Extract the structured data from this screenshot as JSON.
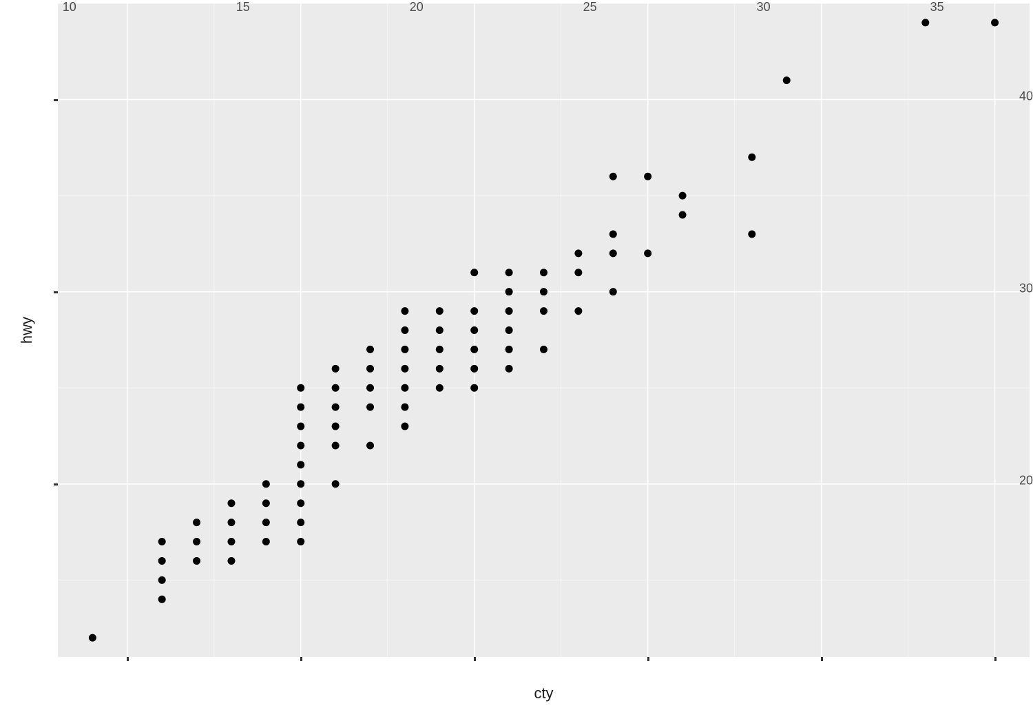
{
  "chart_data": {
    "type": "scatter",
    "xlabel": "cty",
    "ylabel": "hwy",
    "xlim": [
      8,
      36
    ],
    "ylim": [
      11,
      45
    ],
    "x_ticks": [
      10,
      15,
      20,
      25,
      30,
      35
    ],
    "y_ticks": [
      20,
      30,
      40
    ],
    "x_minor": [
      12.5,
      17.5,
      22.5,
      27.5,
      32.5
    ],
    "y_minor": [
      15,
      25,
      35,
      45
    ],
    "point_radius": 5.5,
    "points": [
      [
        9,
        12
      ],
      [
        11,
        14
      ],
      [
        11,
        15
      ],
      [
        11,
        16
      ],
      [
        11,
        17
      ],
      [
        12,
        16
      ],
      [
        12,
        17
      ],
      [
        12,
        18
      ],
      [
        13,
        16
      ],
      [
        13,
        17
      ],
      [
        13,
        18
      ],
      [
        13,
        19
      ],
      [
        14,
        17
      ],
      [
        14,
        18
      ],
      [
        14,
        19
      ],
      [
        14,
        20
      ],
      [
        15,
        17
      ],
      [
        15,
        18
      ],
      [
        15,
        19
      ],
      [
        15,
        20
      ],
      [
        15,
        21
      ],
      [
        15,
        22
      ],
      [
        15,
        23
      ],
      [
        15,
        24
      ],
      [
        15,
        25
      ],
      [
        16,
        20
      ],
      [
        16,
        22
      ],
      [
        16,
        23
      ],
      [
        16,
        24
      ],
      [
        16,
        25
      ],
      [
        16,
        26
      ],
      [
        17,
        22
      ],
      [
        17,
        24
      ],
      [
        17,
        25
      ],
      [
        17,
        26
      ],
      [
        17,
        27
      ],
      [
        18,
        23
      ],
      [
        18,
        24
      ],
      [
        18,
        25
      ],
      [
        18,
        26
      ],
      [
        18,
        27
      ],
      [
        18,
        28
      ],
      [
        18,
        29
      ],
      [
        19,
        25
      ],
      [
        19,
        26
      ],
      [
        19,
        27
      ],
      [
        19,
        28
      ],
      [
        19,
        29
      ],
      [
        20,
        25
      ],
      [
        20,
        26
      ],
      [
        20,
        27
      ],
      [
        20,
        28
      ],
      [
        20,
        29
      ],
      [
        20,
        31
      ],
      [
        21,
        26
      ],
      [
        21,
        27
      ],
      [
        21,
        28
      ],
      [
        21,
        29
      ],
      [
        21,
        30
      ],
      [
        21,
        31
      ],
      [
        22,
        27
      ],
      [
        22,
        29
      ],
      [
        22,
        30
      ],
      [
        22,
        31
      ],
      [
        23,
        29
      ],
      [
        23,
        31
      ],
      [
        23,
        32
      ],
      [
        24,
        30
      ],
      [
        24,
        32
      ],
      [
        24,
        33
      ],
      [
        24,
        36
      ],
      [
        25,
        32
      ],
      [
        25,
        36
      ],
      [
        26,
        34
      ],
      [
        26,
        35
      ],
      [
        28,
        33
      ],
      [
        28,
        37
      ],
      [
        29,
        41
      ],
      [
        33,
        44
      ],
      [
        35,
        44
      ]
    ]
  }
}
